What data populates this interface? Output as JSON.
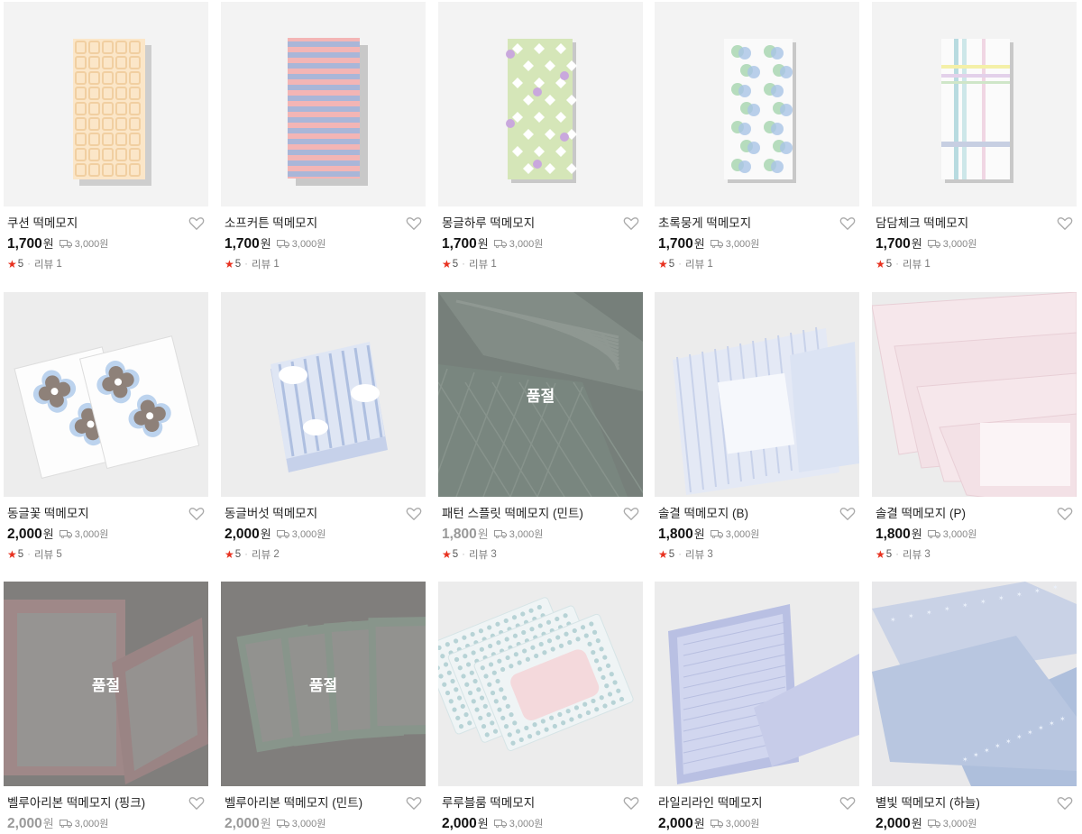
{
  "products": [
    {
      "name": "쿠션 떡메모지",
      "price": "1,700",
      "currency": "원",
      "shipping": "3,000원",
      "rating": "5",
      "review_label": "리뷰",
      "review_count": "1",
      "soldout": false,
      "pattern": "cream-lattice"
    },
    {
      "name": "소프커튼 떡메모지",
      "price": "1,700",
      "currency": "원",
      "shipping": "3,000원",
      "rating": "5",
      "review_label": "리뷰",
      "review_count": "1",
      "soldout": false,
      "pattern": "pink-blue-stripes"
    },
    {
      "name": "몽글하루 떡메모지",
      "price": "1,700",
      "currency": "원",
      "shipping": "3,000원",
      "rating": "5",
      "review_label": "리뷰",
      "review_count": "1",
      "soldout": false,
      "pattern": "green-diamonds"
    },
    {
      "name": "초록뭉게 떡메모지",
      "price": "1,700",
      "currency": "원",
      "shipping": "3,000원",
      "rating": "5",
      "review_label": "리뷰",
      "review_count": "1",
      "soldout": false,
      "pattern": "blue-green-clouds"
    },
    {
      "name": "담담체크 떡메모지",
      "price": "1,700",
      "currency": "원",
      "shipping": "3,000원",
      "rating": "5",
      "review_label": "리뷰",
      "review_count": "1",
      "soldout": false,
      "pattern": "pastel-check"
    },
    {
      "name": "동글꽃 떡메모지",
      "price": "2,000",
      "currency": "원",
      "shipping": "3,000원",
      "rating": "5",
      "review_label": "리뷰",
      "review_count": "5",
      "soldout": false,
      "pattern": "round-flowers"
    },
    {
      "name": "동글버섯 떡메모지",
      "price": "2,000",
      "currency": "원",
      "shipping": "3,000원",
      "rating": "5",
      "review_label": "리뷰",
      "review_count": "2",
      "soldout": false,
      "pattern": "blue-mushroom-stack"
    },
    {
      "name": "패턴 스플릿 떡메모지 (민트)",
      "price": "1,800",
      "currency": "원",
      "shipping": "3,000원",
      "rating": "5",
      "review_label": "리뷰",
      "review_count": "3",
      "soldout": true,
      "pattern": "mint-split"
    },
    {
      "name": "솔결 떡메모지 (B)",
      "price": "1,800",
      "currency": "원",
      "shipping": "3,000원",
      "rating": "5",
      "review_label": "리뷰",
      "review_count": "3",
      "soldout": false,
      "pattern": "blue-brush"
    },
    {
      "name": "솔결 떡메모지 (P)",
      "price": "1,800",
      "currency": "원",
      "shipping": "3,000원",
      "rating": "5",
      "review_label": "리뷰",
      "review_count": "3",
      "soldout": false,
      "pattern": "pink-brush"
    },
    {
      "name": "벨루아리본 떡메모지 (핑크)",
      "price": "2,000",
      "currency": "원",
      "shipping": "3,000원",
      "soldout": true,
      "pattern": "pink-ribbon"
    },
    {
      "name": "벨루아리본 떡메모지 (민트)",
      "price": "2,000",
      "currency": "원",
      "shipping": "3,000원",
      "soldout": true,
      "pattern": "mint-ribbon"
    },
    {
      "name": "루루블룸 떡메모지",
      "price": "2,000",
      "currency": "원",
      "shipping": "3,000원",
      "soldout": false,
      "pattern": "pink-dot-frame"
    },
    {
      "name": "라일리라인 떡메모지",
      "price": "2,000",
      "currency": "원",
      "shipping": "3,000원",
      "soldout": false,
      "pattern": "lilac-lines"
    },
    {
      "name": "별빛 떡메모지 (하늘)",
      "price": "2,000",
      "currency": "원",
      "shipping": "3,000원",
      "soldout": false,
      "pattern": "sky-stars"
    }
  ],
  "soldout_label": "품절",
  "colors": {
    "star": "#e8311f",
    "soldout_overlay": "#5a5a5a",
    "dim_price": "#999999"
  }
}
